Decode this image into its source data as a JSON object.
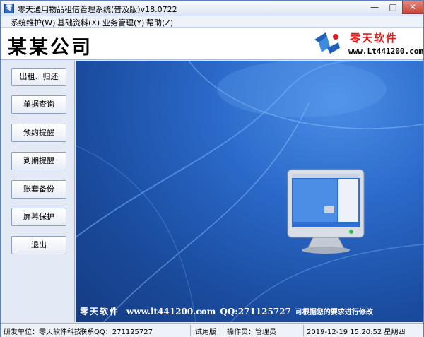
{
  "window": {
    "title": "零天通用物品租借管理系统(普及版)v18.0722",
    "icon": "app-icon",
    "icon_glyph": "零",
    "min_glyph": "—",
    "max_glyph": "□",
    "close_glyph": "✕"
  },
  "menu": {
    "items": [
      {
        "label": "系统维护(W)"
      },
      {
        "label": "基础资料(X)"
      },
      {
        "label": "业务管理(Y)"
      },
      {
        "label": "帮助(Z)"
      }
    ]
  },
  "header": {
    "company_name": "某某公司",
    "logo_brand": "零天软件",
    "logo_url": "www.Lt441200.com"
  },
  "nav": {
    "buttons": [
      {
        "label": "出租、归还"
      },
      {
        "label": "单据查询"
      },
      {
        "label": "预约提醒"
      },
      {
        "label": "到期提醒"
      },
      {
        "label": "账套备份"
      },
      {
        "label": "屏幕保护"
      },
      {
        "label": "退出"
      }
    ]
  },
  "main": {
    "slogan_brand": "零天软件",
    "slogan_url": "www.lt441200.com",
    "slogan_qq": "QQ:271125727",
    "slogan_tail": "可根据您的要求进行修改"
  },
  "status": {
    "developer": "研发单位：零天软件科技",
    "contact_qq": "联系QQ：271125727",
    "edition": "试用版",
    "operator": "操作员：管理员",
    "datetime": "2019-12-19 15:20:52 星期四"
  },
  "colors": {
    "accent": "#2a68c8",
    "brand_red": "#d91c1c"
  }
}
